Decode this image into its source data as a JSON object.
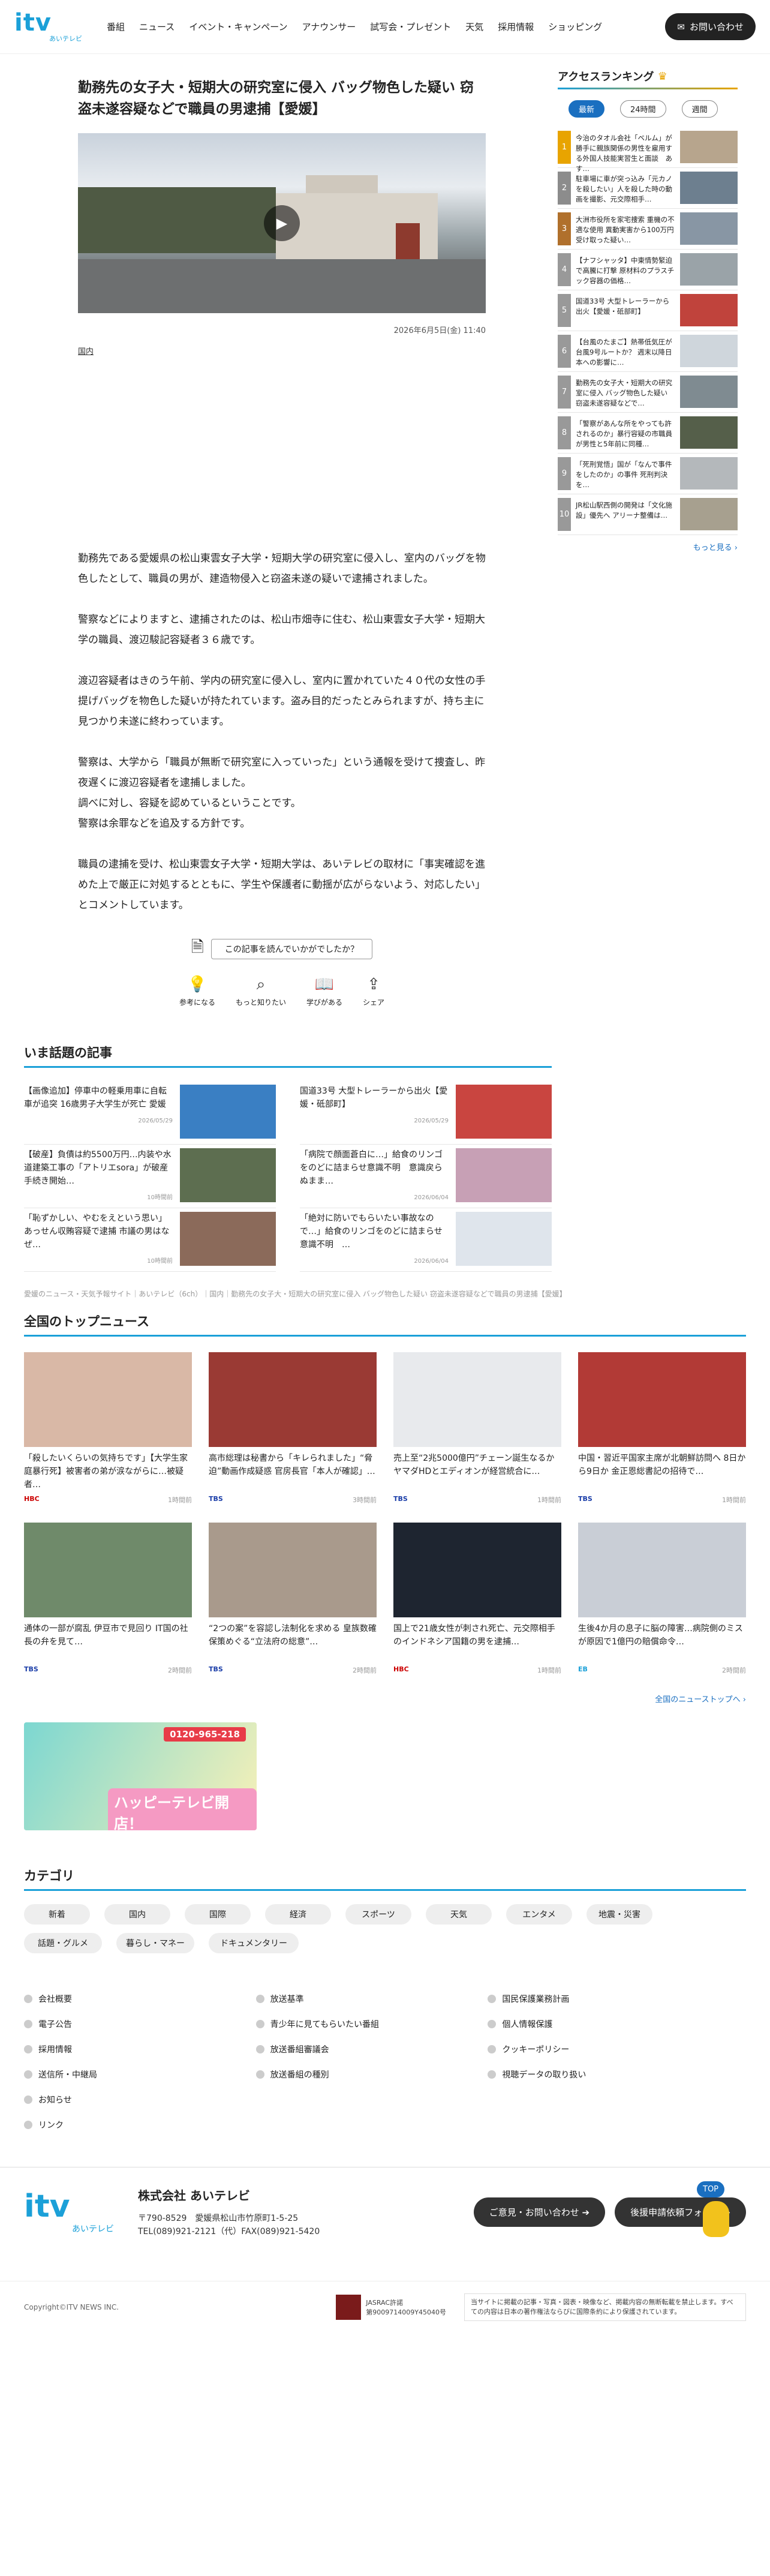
{
  "header": {
    "logo_main": "itv",
    "logo_sub": "あいテレビ",
    "nav": [
      "番組",
      "ニュース",
      "イベント・キャンペーン",
      "アナウンサー",
      "試写会・プレゼント",
      "天気",
      "採用情報",
      "ショッピング"
    ],
    "contact": "お問い合わせ"
  },
  "article": {
    "title": "勤務先の女子大・短期大の研究室に侵入 バッグ物色した疑い 窃盗未遂容疑などで職員の男逮捕【愛媛】",
    "date": "2026年6月5日(金) 11:40",
    "category": "国内",
    "paragraphs": [
      "勤務先である愛媛県の松山東雲女子大学・短期大学の研究室に侵入し、室内のバッグを物色したとして、職員の男が、建造物侵入と窃盗未遂の疑いで逮捕されました。",
      "警察などによりますと、逮捕されたのは、松山市畑寺に住む、松山東雲女子大学・短期大学の職員、渡辺駿記容疑者３６歳です。",
      "渡辺容疑者はきのう午前、学内の研究室に侵入し、室内に置かれていた４０代の女性の手提げバッグを物色した疑いが持たれています。盗み目的だったとみられますが、持ち主に見つかり未遂に終わっています。",
      "警察は、大学から「職員が無断で研究室に入っていった」という通報を受けて捜査し、昨夜遅くに渡辺容疑者を逮捕しました。\n調べに対し、容疑を認めているということです。\n警察は余罪などを追及する方針です。",
      "職員の逮捕を受け、松山東雲女子大学・短期大学は、あいテレビの取材に「事実確認を進めた上で厳正に対処するとともに、学生や保護者に動揺が広がらないよう、対応したい」とコメントしています。"
    ],
    "survey_question": "この記事を読んでいかがでしたか？",
    "reactions": [
      "参考になる",
      "もっと知りたい",
      "学びがある",
      "シェア"
    ]
  },
  "ranking": {
    "title": "アクセスランキング",
    "tabs": [
      "最新",
      "24時間",
      "週間"
    ],
    "items": [
      {
        "num": "1",
        "text": "今治のタオル会社「ベルム」が勝手に親族関係の男性を雇用する外国人技能実習生と面談　あす…"
      },
      {
        "num": "2",
        "text": "駐車場に車が突っ込み「元カノを殺したい」人を殺した時の動画を撮影、元交際相手…"
      },
      {
        "num": "3",
        "text": "大洲市役所を家宅捜索 重機の不適な使用 異動実害から100万円受け取った疑い…"
      },
      {
        "num": "4",
        "text": "【ナフシャッタ】中東情勢緊迫で高騰に打撃 原材料のプラスチック容器の価格…"
      },
      {
        "num": "5",
        "text": "国道33号 大型トレーラーから出火【愛媛・砥部町】"
      },
      {
        "num": "6",
        "text": "【台風のたまご】熱帯低気圧が台風9号ルートか？ 週末以降日本への影響に…"
      },
      {
        "num": "7",
        "text": "勤務先の女子大・短期大の研究室に侵入 バッグ物色した疑い 窃盗未遂容疑などで…"
      },
      {
        "num": "8",
        "text": "「警察があんな所をやっても許されるのか」暴行容疑の市職員が男性と5年前に同種…"
      },
      {
        "num": "9",
        "text": "「死刑覚悟」国が「なんで事件をしたのか」の事件 死刑判決を…"
      },
      {
        "num": "10",
        "text": "JR松山駅西側の開発は「文化施設」優先へ アリーナ整備は…"
      }
    ],
    "more": "もっと見る"
  },
  "hot": {
    "title": "いま話題の記事",
    "items": [
      {
        "text": "【画像追加】停車中の軽乗用車に自転車が追突 16歳男子大学生が死亡 愛媛",
        "date": "2026/05/29"
      },
      {
        "text": "国道33号 大型トレーラーから出火【愛媛・砥部町】",
        "date": "2026/05/29"
      },
      {
        "text": "【破産】負債は約5500万円…内装や水道建築工事の「アトリエsora」が破産手続き開始…",
        "date": "10時間前"
      },
      {
        "text": "「病院で顔面蒼白に…」給食のリンゴをのどに詰まらせ意識不明　意識戻らぬまま…",
        "date": "2026/06/04"
      },
      {
        "text": "「恥ずかしい、やむをえという思い」あっせん収賄容疑で逮捕 市議の男はなぜ…",
        "date": "10時間前"
      },
      {
        "text": "「絶対に防いでもらいたい事故なので…」給食のリンゴをのどに詰まらせ意識不明　…",
        "date": "2026/06/04"
      }
    ]
  },
  "breadcrumb": "愛媛のニュース・天気予報サイト｜あいテレビ（6ch）｜国内｜勤務先の女子大・短期大の研究室に侵入 バッグ物色した疑い 窃盗未遂容疑などで職員の男逮捕【愛媛】",
  "topnews": {
    "title": "全国のトップニュース",
    "items": [
      {
        "text": "「殺したいくらいの気持ちです」【大学生家庭暴行死】被害者の弟が涙ながらに…被疑者…",
        "source": "HBC",
        "date": "1時間前"
      },
      {
        "text": "高市総理は秘書から「キレられました」“脅迫”動画作成疑惑 官房長官「本人が確認」…",
        "source": "TBS",
        "date": "3時間前"
      },
      {
        "text": "売上至“2兆5000億円”チェーン誕生なるか ヤマダHDとエディオンが経営統合に…",
        "source": "TBS",
        "date": "1時間前"
      },
      {
        "text": "中国・習近平国家主席が北朝鮮訪問へ 8日から9日か 金正恩総書記の招待で…",
        "source": "TBS",
        "date": "1時間前"
      },
      {
        "text": "通体の一部が腐乱 伊豆市で見回り IT国の社長の弁を見て…",
        "source": "TBS",
        "date": "2時間前"
      },
      {
        "text": "“2つの案”を容認し法制化を求める 皇族数確保策めぐる“立法府の総意”…",
        "source": "TBS",
        "date": "2時間前"
      },
      {
        "text": "国上で21歳女性が刺され死亡、元交際相手のインドネシア国籍の男を逮捕…",
        "source": "HBC",
        "date": "1時間前"
      },
      {
        "text": "生後4か月の息子に脳の障害…病院側のミスが原因で1億円の賠償命令…",
        "source": "EB",
        "date": "2時間前"
      }
    ],
    "more": "全国のニューストップへ"
  },
  "banner": {
    "tel": "0120-965-218",
    "title": "ハッピーテレビ開店！"
  },
  "categories": {
    "title": "カテゴリ",
    "chips": [
      "新着",
      "国内",
      "国際",
      "経済",
      "スポーツ",
      "天気",
      "エンタメ",
      "地震・災害",
      "話題・グルメ",
      "暮らし・マネー",
      "ドキュメンタリー"
    ]
  },
  "footer_links": [
    "会社概要",
    "放送基準",
    "国民保護業務計画",
    "電子公告",
    "青少年に見てもらいたい番組",
    "個人情報保護",
    "採用情報",
    "放送番組審議会",
    "クッキーポリシー",
    "送信所・中継局",
    "放送番組の種別",
    "視聴データの取り扱い",
    "お知らせ",
    "リンク"
  ],
  "top_button": "TOP",
  "company": {
    "name": "株式会社 あいテレビ",
    "address": "〒790-8529　愛媛県松山市竹原町1-5-25",
    "tel": "TEL(089)921-2121（代）FAX(089)921-5420",
    "btn1": "ご意見・お問い合わせ",
    "btn2": "後援申請依頼フォーム"
  },
  "copyright": "Copyright©ITV NEWS INC.",
  "jasrac": "JASRAC許諾\n第9009714009Y45040号",
  "disclaimer": "当サイトに掲載の記事・写真・図表・映像など、掲載内容の無断転載を禁止します。すべての内容は日本の著作権法ならびに国際条約により保護されています。"
}
